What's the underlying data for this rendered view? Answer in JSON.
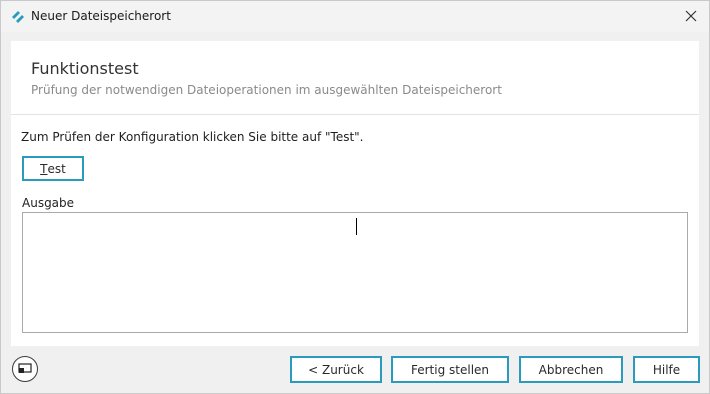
{
  "window": {
    "title": "Neuer Dateispeicherort"
  },
  "header": {
    "title": "Funktionstest",
    "subtitle": "Prüfung der notwendigen Dateioperationen im ausgewählten Dateispeicherort"
  },
  "main": {
    "instruction": "Zum Prüfen der Konfiguration klicken Sie bitte auf \"Test\".",
    "test_button": {
      "accel": "T",
      "rest": "est"
    },
    "output_label": "Ausgabe",
    "output_value": ""
  },
  "footer": {
    "back_label": "< Zurück",
    "finish_label": "Fertig stellen",
    "cancel_label": "Abbrechen",
    "help_label": "Hilfe"
  },
  "icons": {
    "app": "app-logo-icon",
    "close": "close-icon",
    "footer": "screen-icon"
  },
  "colors": {
    "accent": "#2b9bbd",
    "window_bg": "#f0f0f0",
    "panel_bg": "#ffffff",
    "subtitle": "#8a8a8a"
  }
}
